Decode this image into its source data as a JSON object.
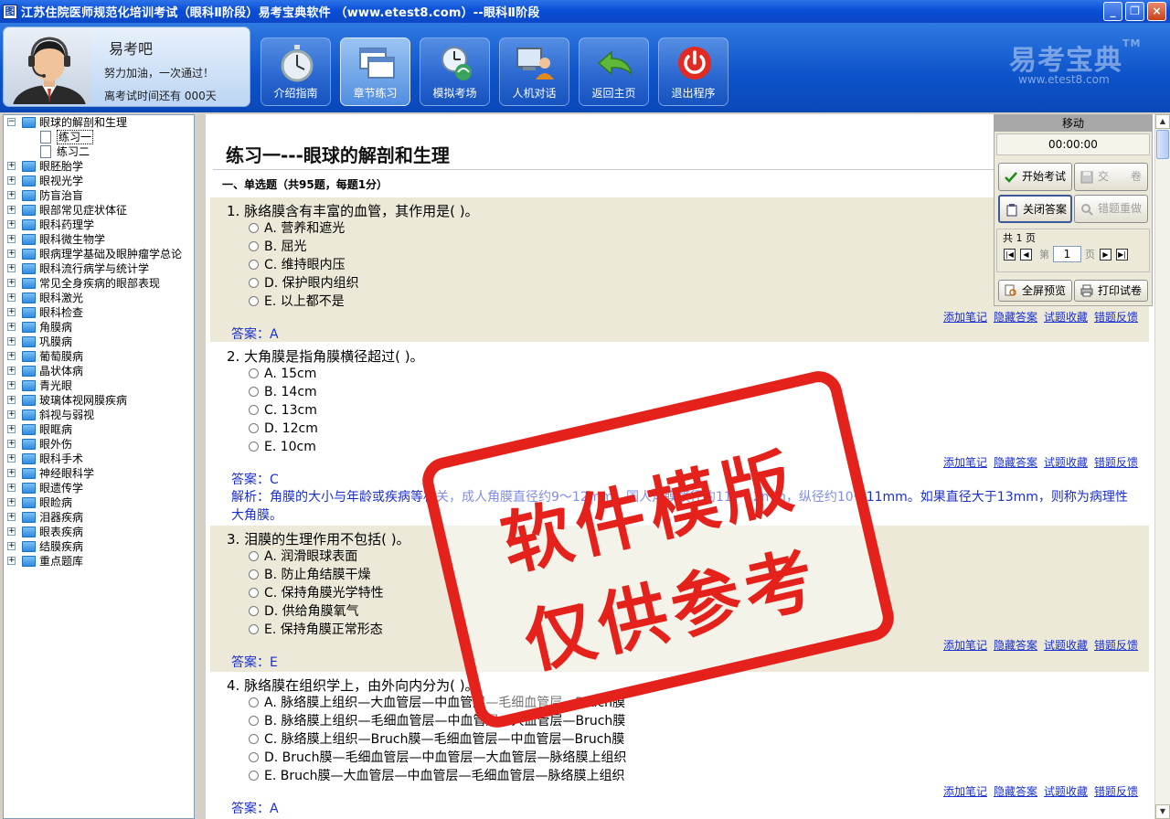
{
  "window": {
    "title": "江苏住院医师规范化培训考试（眼科Ⅱ阶段）易考宝典软件 （www.etest8.com）--眼科Ⅱ阶段",
    "icon_char": "图",
    "buttons": [
      "_",
      "❐",
      "×"
    ]
  },
  "user": {
    "name": "易考吧",
    "motto": "努力加油，一次通过！",
    "countdown": "离考试时间还有 000天"
  },
  "nav": [
    {
      "label": "介绍指南",
      "icon": "stopwatch-icon"
    },
    {
      "label": "章节练习",
      "icon": "windows-icon",
      "active": true
    },
    {
      "label": "模拟考场",
      "icon": "clock-globe-icon"
    },
    {
      "label": "人机对话",
      "icon": "user-computer-icon"
    },
    {
      "label": "返回主页",
      "icon": "return-arrow-icon"
    },
    {
      "label": "退出程序",
      "icon": "power-icon"
    }
  ],
  "brand": {
    "name": "易考宝典",
    "tm": "TM",
    "url": "www.etest8.com"
  },
  "tree": [
    {
      "label": "眼球的解剖和生理",
      "expanded": true,
      "level": 0
    },
    {
      "label": "练习一",
      "level": 1,
      "selected": true
    },
    {
      "label": "练习二",
      "level": 1
    },
    {
      "label": "眼胚胎学",
      "level": 0
    },
    {
      "label": "眼视光学",
      "level": 0
    },
    {
      "label": "防盲治盲",
      "level": 0
    },
    {
      "label": "眼部常见症状体征",
      "level": 0
    },
    {
      "label": "眼科药理学",
      "level": 0
    },
    {
      "label": "眼科微生物学",
      "level": 0
    },
    {
      "label": "眼病理学基础及眼肿瘤学总论",
      "level": 0
    },
    {
      "label": "眼科流行病学与统计学",
      "level": 0
    },
    {
      "label": "常见全身疾病的眼部表现",
      "level": 0
    },
    {
      "label": "眼科激光",
      "level": 0
    },
    {
      "label": "眼科检查",
      "level": 0
    },
    {
      "label": "角膜病",
      "level": 0
    },
    {
      "label": "巩膜病",
      "level": 0
    },
    {
      "label": "葡萄膜病",
      "level": 0
    },
    {
      "label": "晶状体病",
      "level": 0
    },
    {
      "label": "青光眼",
      "level": 0
    },
    {
      "label": "玻璃体视网膜疾病",
      "level": 0
    },
    {
      "label": "斜视与弱视",
      "level": 0
    },
    {
      "label": "眼眶病",
      "level": 0
    },
    {
      "label": "眼外伤",
      "level": 0
    },
    {
      "label": "眼科手术",
      "level": 0
    },
    {
      "label": "神经眼科学",
      "level": 0
    },
    {
      "label": "眼遗传学",
      "level": 0
    },
    {
      "label": "眼睑病",
      "level": 0
    },
    {
      "label": "泪器疾病",
      "level": 0
    },
    {
      "label": "眼表疾病",
      "level": 0
    },
    {
      "label": "结膜疾病",
      "level": 0
    },
    {
      "label": "重点题库",
      "level": 0
    }
  ],
  "page": {
    "title": "练习一---眼球的解剖和生理",
    "section": "一、单选题（共95题，每题1分）"
  },
  "question_links": [
    "添加笔记",
    "隐藏答案",
    "试题收藏",
    "错题反馈"
  ],
  "questions": [
    {
      "text": "1. 脉络膜含有丰富的血管，其作用是(  )。",
      "options": [
        "A. 营养和遮光",
        "B. 屈光",
        "C. 维持眼内压",
        "D. 保护眼内组织",
        "E. 以上都不是"
      ],
      "answer": "答案：A"
    },
    {
      "text": "2. 大角膜是指角膜横径超过(  )。",
      "options": [
        "A. 15cm",
        "B. 14cm",
        "C. 13cm",
        "D. 12cm",
        "E. 10cm"
      ],
      "answer": "答案：C",
      "analysis": "解析：角膜的大小与年龄或疾病等相关，成人角膜直径约9～12mm，国人角膜横径约11～12mm，纵径约10～11mm。如果直径大于13mm，则称为病理性大角膜。"
    },
    {
      "text": "3. 泪膜的生理作用不包括(  )。",
      "options": [
        "A. 润滑眼球表面",
        "B. 防止角结膜干燥",
        "C. 保持角膜光学特性",
        "D. 供给角膜氧气",
        "E. 保持角膜正常形态"
      ],
      "answer": "答案：E"
    },
    {
      "text": "4. 脉络膜在组织学上，由外向内分为(  )。",
      "options": [
        "A. 脉络膜上组织—大血管层—中血管层—毛细血管层—Bruch膜",
        "B. 脉络膜上组织—毛细血管层—中血管层—大血管层—Bruch膜",
        "C. 脉络膜上组织—Bruch膜—毛细血管层—中血管层—Bruch膜",
        "D. Bruch膜—毛细血管层—中血管层—大血管层—脉络膜上组织",
        "E. Bruch膜—大血管层—中血管层—毛细血管层—脉络膜上组织"
      ],
      "answer": "答案：A"
    }
  ],
  "panel": {
    "header": "移动",
    "timer": "00:00:00",
    "start": "开始考试",
    "submit": "交　　卷",
    "close_answer": "关闭答案",
    "redo": "错题重做",
    "total_pages": "共 1 页",
    "page_prefix": "第",
    "page_value": "1",
    "page_suffix": "页",
    "fullscreen": "全屏预览",
    "print": "打印试卷"
  },
  "stamp": {
    "line1": "软件模版",
    "line2": "仅供参考"
  }
}
